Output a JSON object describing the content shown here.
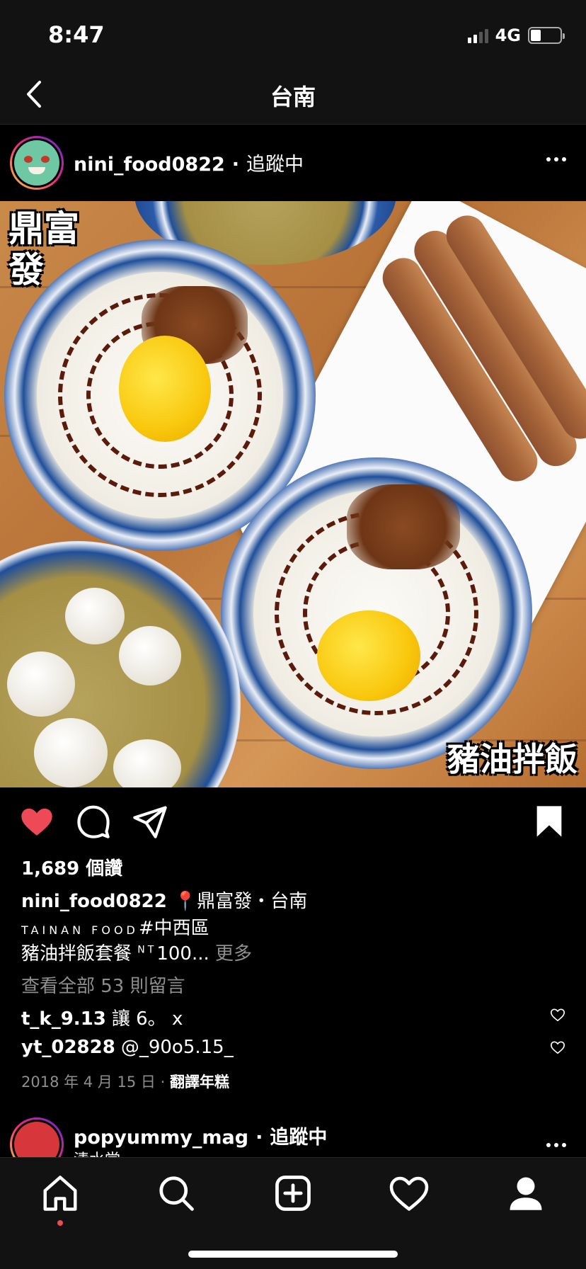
{
  "status_bar": {
    "time": "8:47",
    "network": "4G"
  },
  "navbar": {
    "title": "台南",
    "back_icon": "chevron-left-icon"
  },
  "post": {
    "username": "nini_food0822",
    "separator": "·",
    "follow_status": "追蹤中",
    "image_caption_shop": "鼎富發",
    "image_caption_dish": "豬油拌飯",
    "liked": true,
    "saved": true,
    "like_color": "#ed4956",
    "likes_text": "1,689 個讚",
    "caption": {
      "line1_rest": "📍鼎富發・台南",
      "line2_small": "TAINAN FOOD",
      "line2_tag": "#中西區",
      "line3_text": "豬油拌飯套餐",
      "line3_sup": "NT",
      "line3_price": "100...",
      "more": "更多"
    },
    "view_all_comments": "查看全部 53 則留言",
    "comments": [
      {
        "user": "t_k_9.13",
        "text": "讓 6。 x"
      },
      {
        "user": "yt_02828",
        "text": "@_90o5.15_"
      }
    ],
    "date": "2018 年 4 月 15 日",
    "date_separator": "·",
    "translate": "翻譯年糕"
  },
  "next_post": {
    "username": "popyummy_mag",
    "separator": "·",
    "follow_status": "追蹤中",
    "location": "清水堂"
  },
  "tabbar": {
    "items": [
      "home-icon",
      "search-icon",
      "new-post-icon",
      "activity-heart-icon",
      "profile-icon"
    ],
    "active": "home-icon"
  }
}
